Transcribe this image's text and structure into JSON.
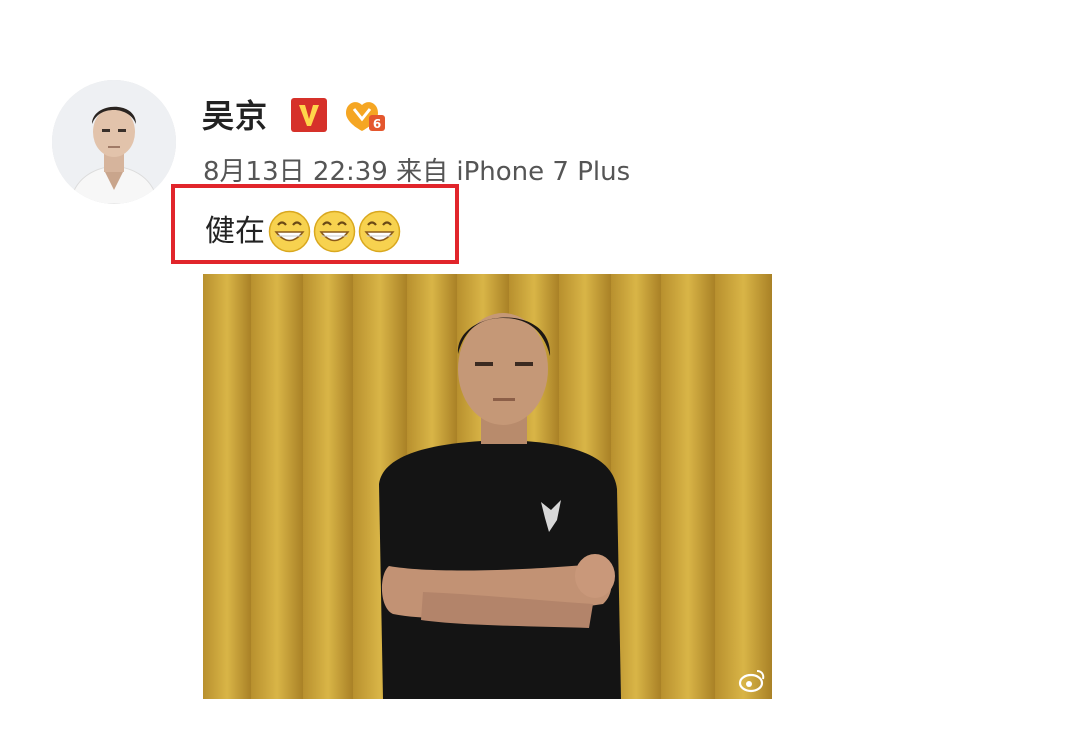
{
  "post": {
    "author": "吴京",
    "verified_icon": "v-verified-badge-icon",
    "member_icon": "vip-level-6-badge-icon",
    "member_level": "6",
    "date": "8月13日",
    "time": "22:39",
    "source_prefix": "来自",
    "source_device": "iPhone 7 Plus",
    "text": "健在",
    "emojis": [
      "grin-emoji-icon",
      "grin-emoji-icon",
      "grin-emoji-icon"
    ],
    "highlight_color": "#e1252b",
    "image_icon": "weibo-watermark-icon"
  }
}
